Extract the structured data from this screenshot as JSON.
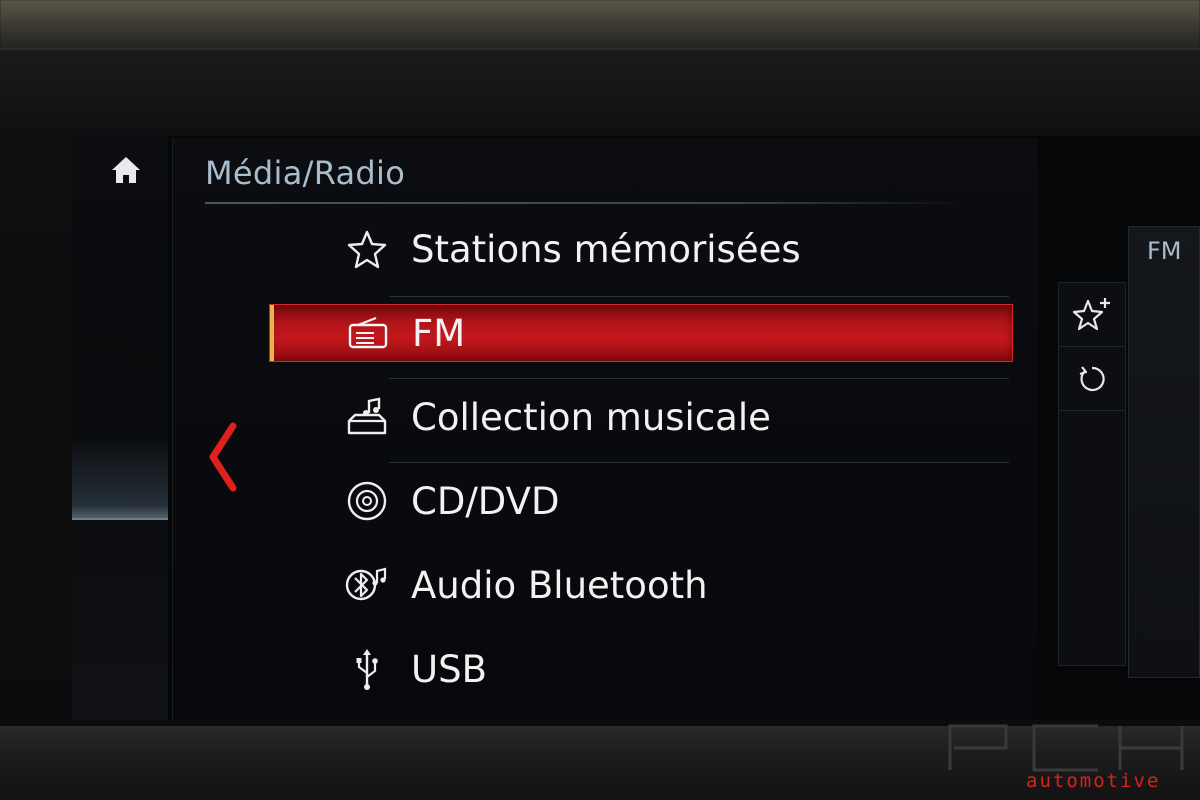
{
  "header": {
    "title": "Média/Radio"
  },
  "menu": {
    "items": [
      {
        "label": "Stations mémorisées",
        "icon": "star-icon",
        "selected": false
      },
      {
        "label": "FM",
        "icon": "radio-icon",
        "selected": true
      },
      {
        "label": "Collection musicale",
        "icon": "music-collection-icon",
        "selected": false
      },
      {
        "label": "CD/DVD",
        "icon": "disc-icon",
        "selected": false
      },
      {
        "label": "Audio Bluetooth",
        "icon": "bluetooth-audio-icon",
        "selected": false
      },
      {
        "label": "USB",
        "icon": "usb-icon",
        "selected": false
      }
    ]
  },
  "right_panel": {
    "title": "FM",
    "buttons": [
      {
        "icon": "add-favorite-icon"
      },
      {
        "icon": "refresh-icon"
      }
    ]
  },
  "watermark": {
    "brand": "PCH",
    "subtitle": "automotive"
  },
  "colors": {
    "accent": "#c2181c",
    "title_text": "#a9bccc",
    "background": "#050608"
  }
}
